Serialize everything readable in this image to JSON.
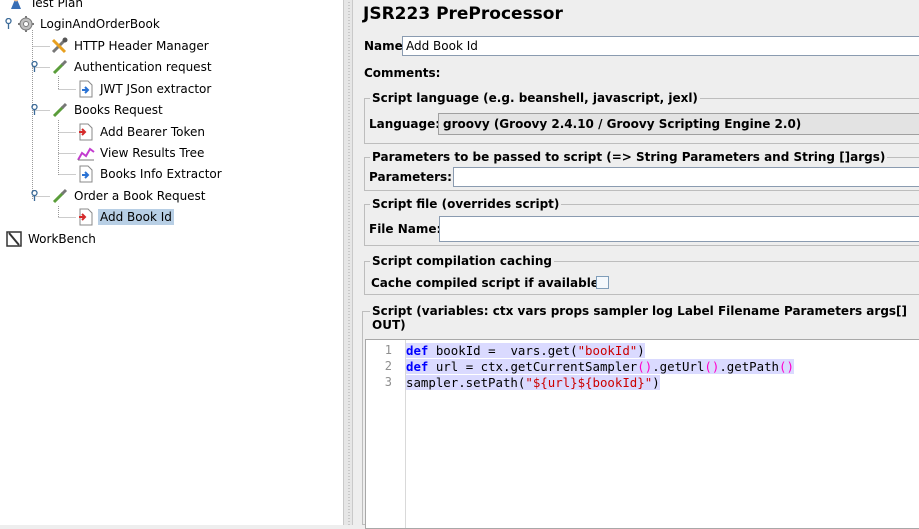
{
  "tree": {
    "items": [
      {
        "label": "Test Plan",
        "icon": "test-plan-icon"
      },
      {
        "label": "LoginAndOrderBook",
        "icon": "thread-group-icon"
      },
      {
        "label": "HTTP Header Manager",
        "icon": "config-tools-icon"
      },
      {
        "label": "Authentication request",
        "icon": "sampler-pipette-icon"
      },
      {
        "label": "JWT JSon extractor",
        "icon": "post-processor-icon"
      },
      {
        "label": "Books Request",
        "icon": "sampler-pipette-icon"
      },
      {
        "label": "Add Bearer Token",
        "icon": "pre-processor-icon"
      },
      {
        "label": "View Results Tree",
        "icon": "listener-icon"
      },
      {
        "label": "Books Info Extractor",
        "icon": "post-processor-icon"
      },
      {
        "label": "Order a Book Request",
        "icon": "sampler-pipette-icon"
      },
      {
        "label": "Add Book Id",
        "icon": "pre-processor-icon",
        "selected": true
      },
      {
        "label": "WorkBench",
        "icon": "workbench-icon"
      }
    ]
  },
  "panel": {
    "title": "JSR223 PreProcessor",
    "name_label": "Name:",
    "name_value": "Add Book Id",
    "comments_label": "Comments:",
    "script_language": {
      "group_title": "Script language (e.g. beanshell, javascript, jexl)",
      "label": "Language:",
      "value": "groovy     (Groovy 2.4.10 / Groovy Scripting Engine 2.0)"
    },
    "parameters": {
      "group_title": "Parameters to be passed to script (=> String Parameters and String []args)",
      "label": "Parameters:",
      "value": ""
    },
    "script_file": {
      "group_title": "Script file (overrides script)",
      "label": "File Name:",
      "value": ""
    },
    "caching": {
      "group_title": "Script compilation caching",
      "label": "Cache compiled script if available:",
      "checked": false
    },
    "script": {
      "group_title": "Script (variables: ctx vars props sampler log Label Filename Parameters args[] OUT)",
      "lines": [
        {
          "number": "1",
          "text": "def bookId =  vars.get(\"bookId\")"
        },
        {
          "number": "2",
          "text": "def url = ctx.getCurrentSampler().getUrl().getPath()"
        },
        {
          "number": "3",
          "text": "sampler.setPath(\"${url}${bookId}\")"
        }
      ]
    }
  },
  "colors": {
    "selection": "#b8cfe5",
    "keyword": "#0000ff",
    "string": "#cc0000",
    "line_highlight": "#dadaff"
  }
}
